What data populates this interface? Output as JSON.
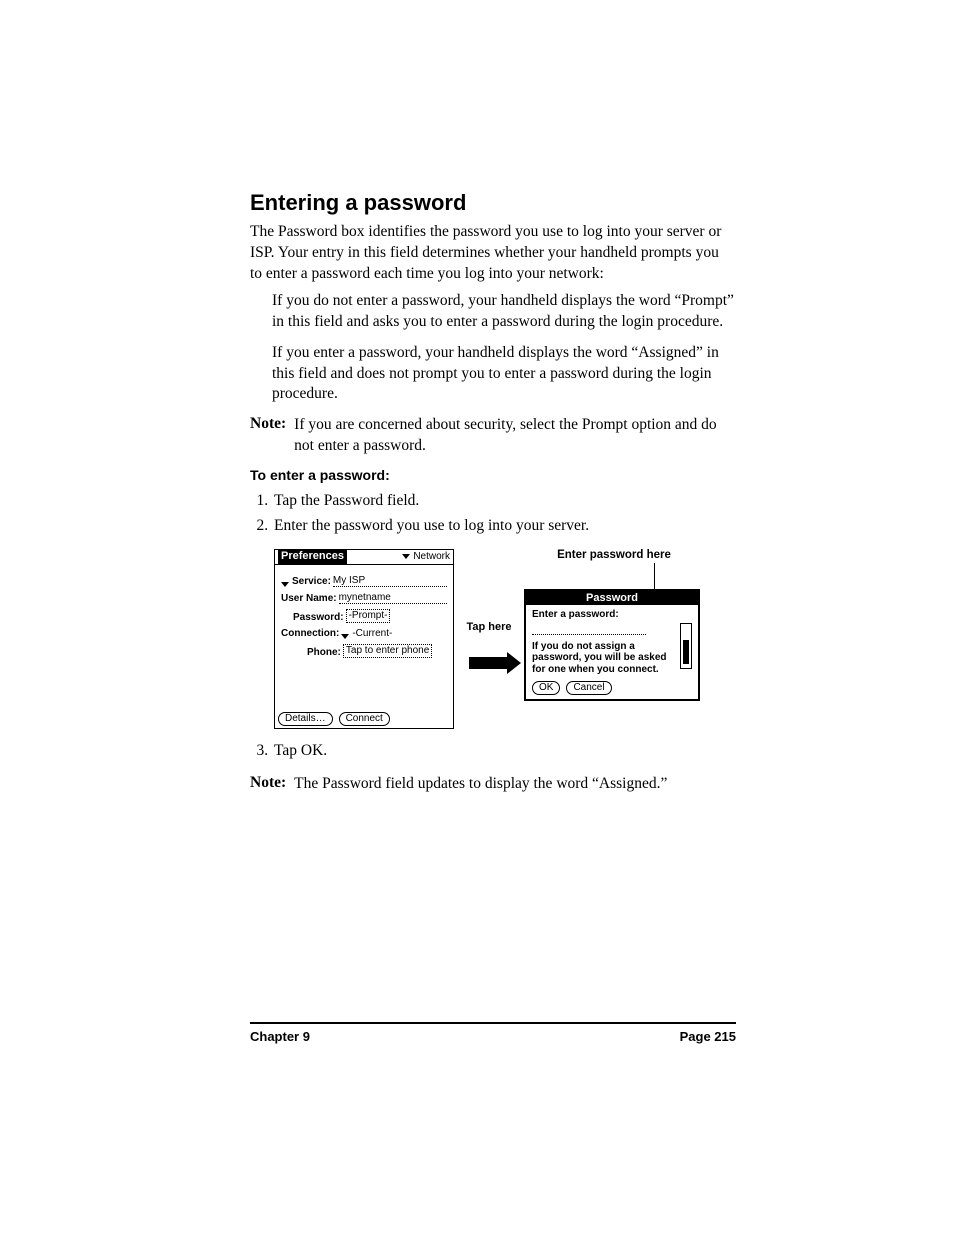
{
  "heading": "Entering a password",
  "intro": "The Password box identifies the password you use to log into your server or ISP. Your entry in this field determines whether your handheld prompts you to enter a password each time you log into your network:",
  "bullet1": "If you do not enter a password, your handheld displays the word “Prompt” in this field and asks you to enter a password during the login procedure.",
  "bullet2": "If you enter a password, your handheld displays the word “Assigned” in this field and does not prompt you to enter a password during the login procedure.",
  "note1_label": "Note:",
  "note1_text": "If you are concerned about security, select the Prompt option and do not enter a password.",
  "proc_title": "To enter a password:",
  "steps": {
    "s1": "Tap the Password field.",
    "s2": "Enter the password you use to log into your server.",
    "s3": "Tap OK."
  },
  "note2_label": "Note:",
  "note2_text": "The Password field updates to display the word “Assigned.”",
  "figure": {
    "enter_here": "Enter password here",
    "tap_here": "Tap here",
    "prefs": {
      "title_left": "Preferences",
      "title_right": "Network",
      "service_label": "Service:",
      "service_value": "My ISP",
      "user_label": "User Name:",
      "user_value": "mynetname",
      "password_label": "Password:",
      "password_value": "-Prompt-",
      "connection_label": "Connection:",
      "connection_value": "-Current-",
      "phone_label": "Phone:",
      "phone_value": "Tap to enter phone",
      "button_details": "Details…",
      "button_connect": "Connect"
    },
    "dialog": {
      "title": "Password",
      "prompt": "Enter a password:",
      "hint": "If you do not assign a password, you will be asked for one when you connect.",
      "ok": "OK",
      "cancel": "Cancel"
    }
  },
  "footer": {
    "left": "Chapter 9",
    "right": "Page 215"
  }
}
